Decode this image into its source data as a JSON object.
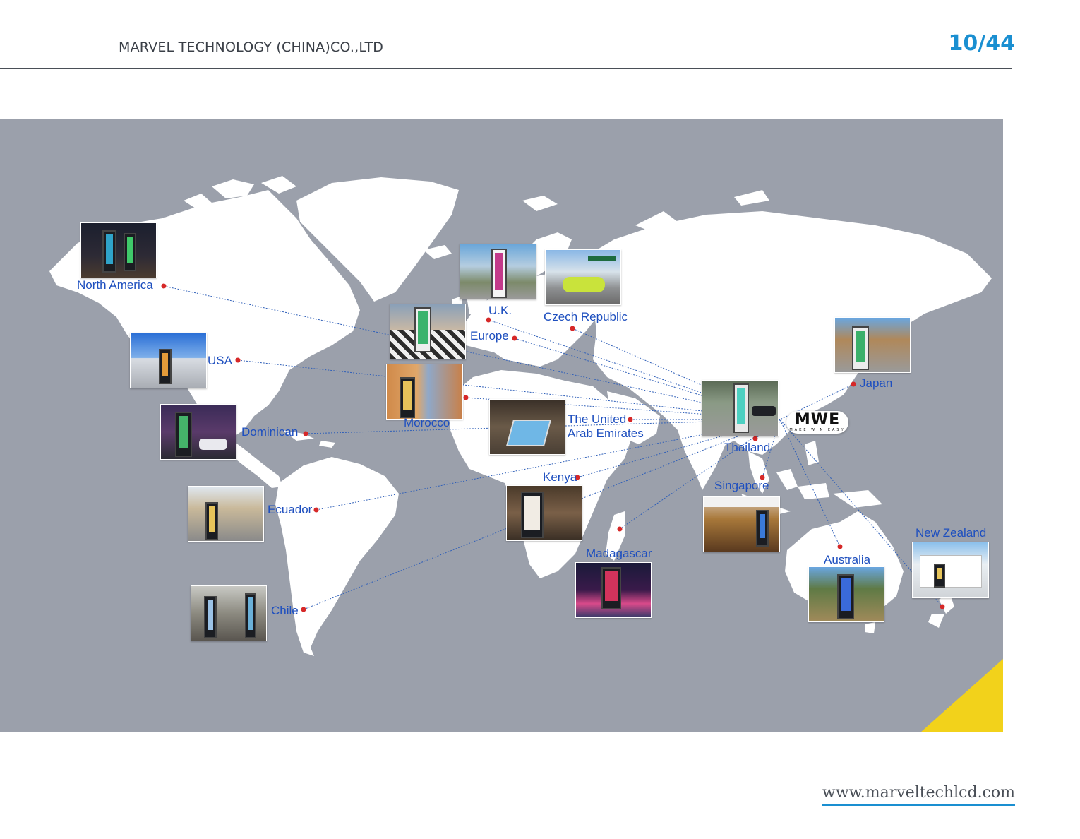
{
  "header": {
    "company": "MARVEL TECHNOLOGY (CHINA)CO.,LTD",
    "page_number": "10/44"
  },
  "map": {
    "hub_logo": "MWE",
    "hub_tagline": "MAKE WIN EASY",
    "locations": [
      {
        "id": "north-america",
        "label": "North America"
      },
      {
        "id": "usa",
        "label": "USA"
      },
      {
        "id": "dominican",
        "label": "Dominican"
      },
      {
        "id": "ecuador",
        "label": "Ecuador"
      },
      {
        "id": "chile",
        "label": "Chile"
      },
      {
        "id": "uk",
        "label": "U.K."
      },
      {
        "id": "europe",
        "label": "Europe"
      },
      {
        "id": "czech-republic",
        "label": "Czech Republic"
      },
      {
        "id": "morocco",
        "label": "Morocco"
      },
      {
        "id": "uae",
        "label": "The United\nArab Emirates"
      },
      {
        "id": "kenya",
        "label": "Kenya"
      },
      {
        "id": "madagascar",
        "label": "Madagascar"
      },
      {
        "id": "thailand",
        "label": "Thailand"
      },
      {
        "id": "singapore",
        "label": "Singapore"
      },
      {
        "id": "japan",
        "label": "Japan"
      },
      {
        "id": "australia",
        "label": "Australia"
      },
      {
        "id": "new-zealand",
        "label": "New Zealand"
      }
    ]
  },
  "colors": {
    "map_background": "#9ba0ab",
    "land": "#ffffff",
    "label_text": "#1e4fbf",
    "marker": "#d62828",
    "connector": "#2f5fb8",
    "page_number": "#1a8fd1",
    "accent_corner": "#f2d21b"
  },
  "footer": {
    "url": "www.marveltechlcd.com"
  }
}
